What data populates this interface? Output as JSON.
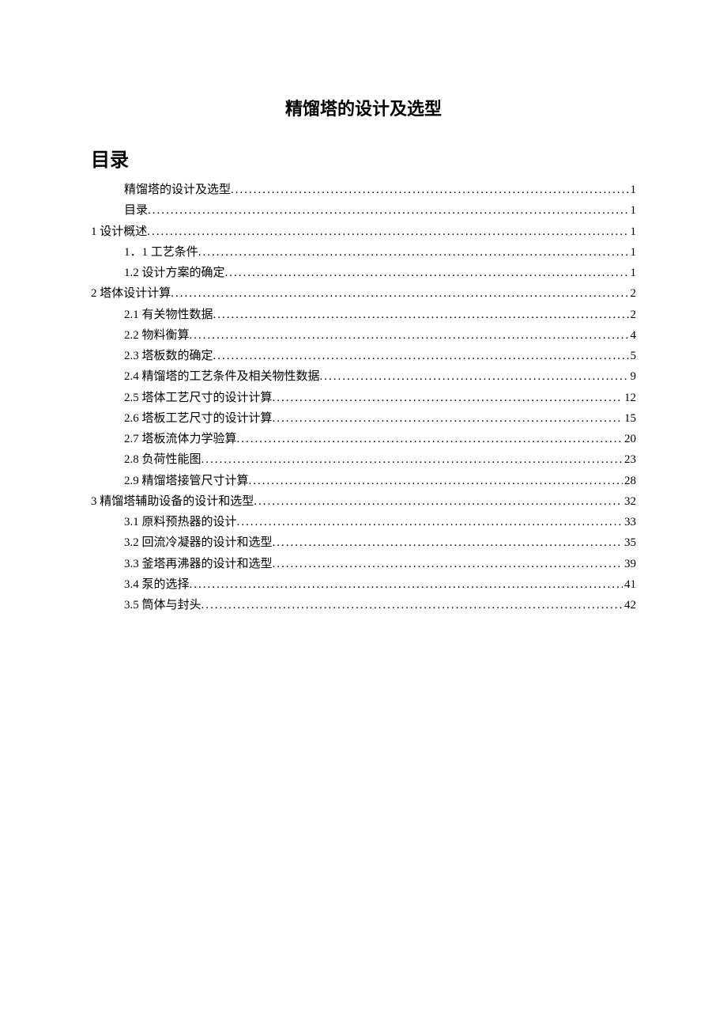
{
  "title": "精馏塔的设计及选型",
  "toc_heading": "目录",
  "toc": [
    {
      "label": "精馏塔的设计及选型",
      "page": "1",
      "indent": true
    },
    {
      "label": "目录",
      "page": "1",
      "indent": true
    },
    {
      "label": "1 设计概述",
      "page": "1",
      "indent": false
    },
    {
      "label": "1．1 工艺条件",
      "page": "1",
      "indent": true
    },
    {
      "label": "1.2 设计方案的确定",
      "page": "1",
      "indent": true
    },
    {
      "label": "2 塔体设计计算",
      "page": "2",
      "indent": false
    },
    {
      "label": "2.1 有关物性数据",
      "page": "2",
      "indent": true
    },
    {
      "label": "2.2 物料衡算",
      "page": "4",
      "indent": true
    },
    {
      "label": "2.3 塔板数的确定",
      "page": "5",
      "indent": true
    },
    {
      "label": "2.4 精馏塔的工艺条件及相关物性数据",
      "page": "9",
      "indent": true
    },
    {
      "label": "2.5 塔体工艺尺寸的设计计算",
      "page": "12",
      "indent": true
    },
    {
      "label": "2.6 塔板工艺尺寸的设计计算",
      "page": "15",
      "indent": true
    },
    {
      "label": "2.7 塔板流体力学验算",
      "page": "20",
      "indent": true
    },
    {
      "label": "2.8 负荷性能图",
      "page": "23",
      "indent": true
    },
    {
      "label": "2.9 精馏塔接管尺寸计算",
      "page": "28",
      "indent": true
    },
    {
      "label": "3 精馏塔辅助设备的设计和选型",
      "page": "32",
      "indent": false
    },
    {
      "label": "3.1 原料预热器的设计",
      "page": "33",
      "indent": true
    },
    {
      "label": "3.2 回流冷凝器的设计和选型",
      "page": "35",
      "indent": true
    },
    {
      "label": "3.3 釜塔再沸器的设计和选型",
      "page": "39",
      "indent": true
    },
    {
      "label": "3.4 泵的选择",
      "page": "41",
      "indent": true
    },
    {
      "label": "3.5 筒体与封头",
      "page": "42",
      "indent": true
    }
  ]
}
